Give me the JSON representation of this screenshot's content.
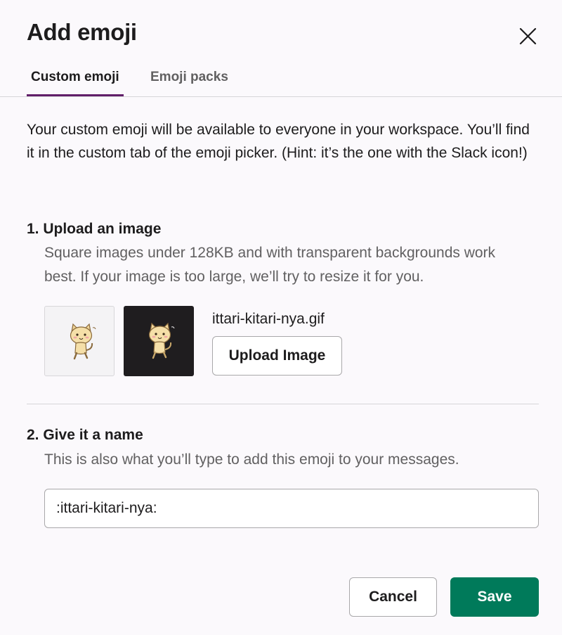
{
  "dialog": {
    "title": "Add emoji"
  },
  "tabs": [
    {
      "label": "Custom emoji",
      "active": true
    },
    {
      "label": "Emoji packs",
      "active": false
    }
  ],
  "intro_text": "Your custom emoji will be available to everyone in your workspace. You’ll find it in the custom tab of the emoji picker. (Hint: it’s the one with the Slack icon!)",
  "upload": {
    "heading": "1. Upload an image",
    "help": "Square images under 128KB and with transparent backgrounds work best. If your image is too large, we’ll try to resize it for you.",
    "filename": "ittari-kitari-nya.gif",
    "button_label": "Upload Image"
  },
  "name": {
    "heading": "2. Give it a name",
    "help": "This is also what you’ll type to add this emoji to your messages.",
    "value": ":ittari-kitari-nya:"
  },
  "footer": {
    "cancel_label": "Cancel",
    "save_label": "Save"
  },
  "colors": {
    "accent_tab": "#611f69",
    "save_button": "#007a5a"
  },
  "icons": {
    "close": "close-icon",
    "preview": "cat-emoji-image"
  }
}
